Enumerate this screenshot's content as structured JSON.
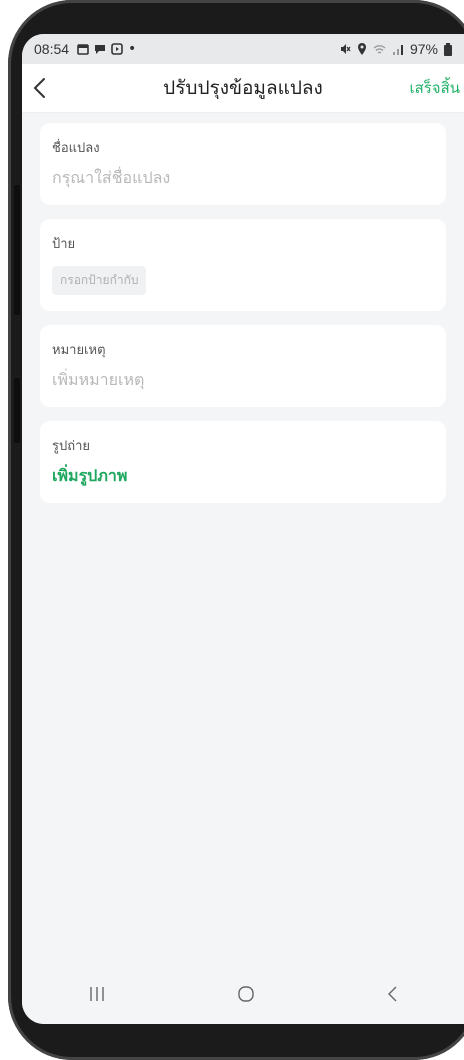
{
  "status_bar": {
    "time": "08:54",
    "battery": "97%"
  },
  "nav": {
    "title": "ปรับปรุงข้อมูลแปลง",
    "done_label": "เสร็จสิ้น"
  },
  "form": {
    "plot_name": {
      "label": "ชื่อแปลง",
      "placeholder": "กรุณาใส่ชื่อแปลง"
    },
    "tag": {
      "label": "ป้าย",
      "button": "กรอกป้ายกำกับ"
    },
    "note": {
      "label": "หมายเหตุ",
      "placeholder": "เพิ่มหมายเหตุ"
    },
    "photo": {
      "label": "รูปถ่าย",
      "add_label": "เพิ่มรูปภาพ"
    }
  },
  "colors": {
    "accent": "#22b16a",
    "background": "#f4f5f7"
  },
  "system_nav": {
    "icons": [
      "recent-apps-icon",
      "home-icon",
      "back-icon"
    ]
  }
}
